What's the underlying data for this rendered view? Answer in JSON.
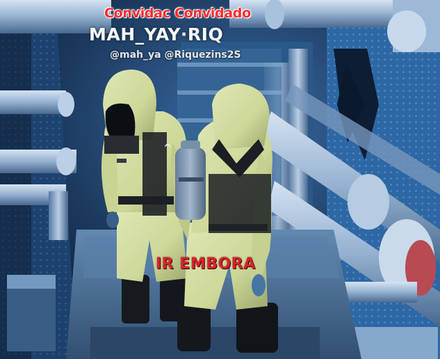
{
  "overlay": {
    "role_tag": "Convidac Convidado",
    "player_name": "MAH_YAY·RIQ",
    "handles": "@mah_ya @Riquezins2S",
    "action_prompt": "IR EMBORA"
  },
  "icons": {
    "interact": "chevron-up-icon"
  },
  "colors": {
    "role_red": "#ff2b2b",
    "action_red": "#d8232a",
    "suit_yellow": "#e6ecaa",
    "ambient_blue": "#3a7fc4"
  }
}
